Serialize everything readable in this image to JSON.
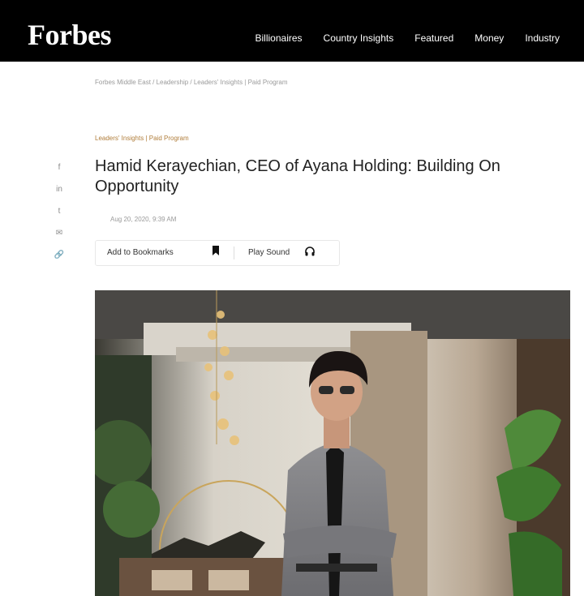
{
  "header": {
    "logo": "Forbes",
    "nav": [
      "Billionaires",
      "Country Insights",
      "Featured",
      "Money",
      "Industry"
    ]
  },
  "breadcrumb": "Forbes Middle East / Leadership / Leaders' Insights | Paid Program",
  "kicker": "Leaders' Insights | Paid Program",
  "article": {
    "title": "Hamid Kerayechian, CEO of Ayana Holding: Building On Opportunity",
    "date": "Aug 20, 2020, 9:39 AM"
  },
  "share": [
    "f",
    "in",
    "t",
    "✉",
    "🔗"
  ],
  "actions": {
    "bookmark_label": "Add to Bookmarks",
    "play_label": "Play Sound"
  }
}
